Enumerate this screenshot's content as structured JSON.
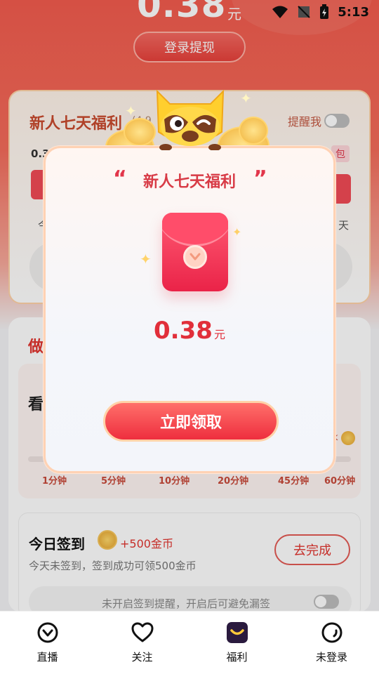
{
  "status_bar": {
    "time": "5:13"
  },
  "balance": {
    "amount": "0.38",
    "unit": "元",
    "withdraw_button": "登录提现"
  },
  "newbie_card": {
    "title": "新人七天福利",
    "subtitle": "(4.9",
    "remind_label": "提醒我",
    "amount_partial": "0.3",
    "redpack_tag": "包",
    "day_left": "今",
    "day_right": "天"
  },
  "tasks_card": {
    "title": "做",
    "watch_title": "看",
    "coin_suffix": "k",
    "ticks": [
      "1分钟",
      "5分钟",
      "10分钟",
      "20分钟",
      "45分钟",
      "60分钟"
    ]
  },
  "signin": {
    "title": "今日签到",
    "reward": "+500金币",
    "desc": "今天未签到，签到成功可领500金币",
    "action": "去完成",
    "reminder_text": "未开启签到提醒，开启后可避免漏签"
  },
  "modal": {
    "title": "新人七天福利",
    "amount": "0.38",
    "unit": "元",
    "claim_button": "立即领取"
  },
  "bottom_nav": [
    {
      "label": "直播",
      "icon": "live-icon"
    },
    {
      "label": "关注",
      "icon": "heart-icon"
    },
    {
      "label": "福利",
      "icon": "welfare-icon"
    },
    {
      "label": "未登录",
      "icon": "profile-icon"
    }
  ],
  "colors": {
    "accent": "#e2352f",
    "brand_red": "#ee2e3e",
    "gold": "#f0b33c"
  }
}
